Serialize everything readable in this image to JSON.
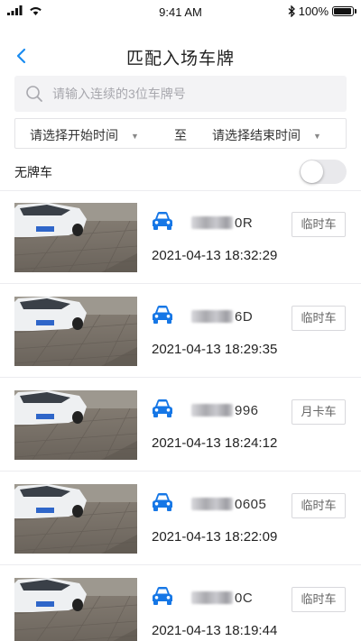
{
  "status_bar": {
    "time": "9:41 AM",
    "battery": "100%",
    "battery_level": 1.0,
    "icons": [
      "signal-icon",
      "wifi-icon",
      "bluetooth-icon",
      "battery-icon"
    ]
  },
  "header": {
    "title": "匹配入场车牌",
    "back_icon": "chevron-left-icon"
  },
  "search": {
    "placeholder": "请输入连续的3位车牌号",
    "value": "",
    "icon": "search-icon"
  },
  "time_range": {
    "start_label": "请选择开始时间",
    "separator": "至",
    "end_label": "请选择结束时间"
  },
  "no_plate": {
    "label": "无牌车",
    "toggle_on": false
  },
  "colors": {
    "accent": "#1a8cf0",
    "car_icon": "#1677e6",
    "divider": "#ececef",
    "search_bg": "#f3f3f5"
  },
  "records": [
    {
      "plate_suffix": "0R",
      "tag": "临时车",
      "time": "2021-04-13 18:32:29"
    },
    {
      "plate_suffix": "6D",
      "tag": "临时车",
      "time": "2021-04-13 18:29:35"
    },
    {
      "plate_suffix": "996",
      "tag": "月卡车",
      "time": "2021-04-13 18:24:12"
    },
    {
      "plate_suffix": "0605",
      "tag": "临时车",
      "time": "2021-04-13 18:22:09"
    },
    {
      "plate_suffix": "0C",
      "tag": "临时车",
      "time": "2021-04-13 18:19:44"
    }
  ]
}
